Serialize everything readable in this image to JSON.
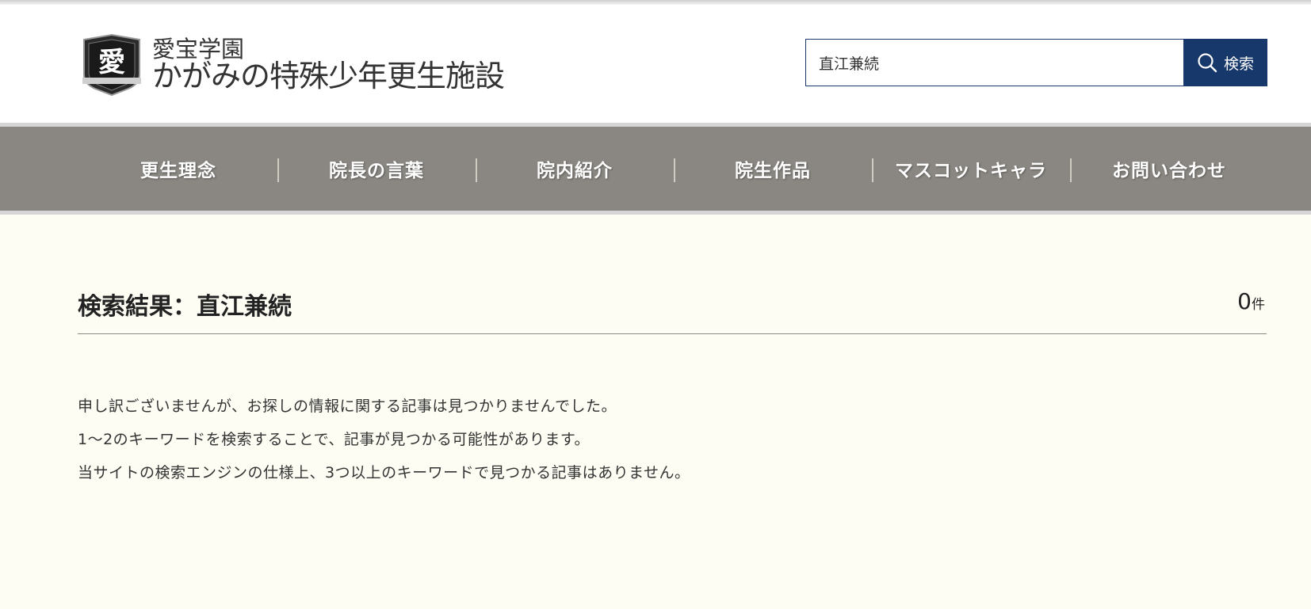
{
  "header": {
    "logo": {
      "emblem_char": "愛",
      "subtitle": "愛宝学園",
      "title": "かがみの特殊少年更生施設"
    },
    "search": {
      "value": "直江兼続",
      "button_label": "検索"
    }
  },
  "nav": {
    "items": [
      {
        "label": "更生理念"
      },
      {
        "label": "院長の言葉"
      },
      {
        "label": "院内紹介"
      },
      {
        "label": "院生作品"
      },
      {
        "label": "マスコットキャラ"
      },
      {
        "label": "お問い合わせ"
      }
    ]
  },
  "results": {
    "heading": "検索結果：直江兼続",
    "count": "0",
    "count_unit": "件",
    "messages": [
      "申し訳ございませんが、お探しの情報に関する記事は見つかりませんでした。",
      "1〜2のキーワードを検索することで、記事が見つかる可能性があります。",
      "当サイトの検索エンジンの仕様上、3つ以上のキーワードで見つかる記事はありません。"
    ]
  },
  "colors": {
    "search_button": "#17386a",
    "nav_bg": "#8a8782",
    "page_bg": "#fdfdf4"
  }
}
